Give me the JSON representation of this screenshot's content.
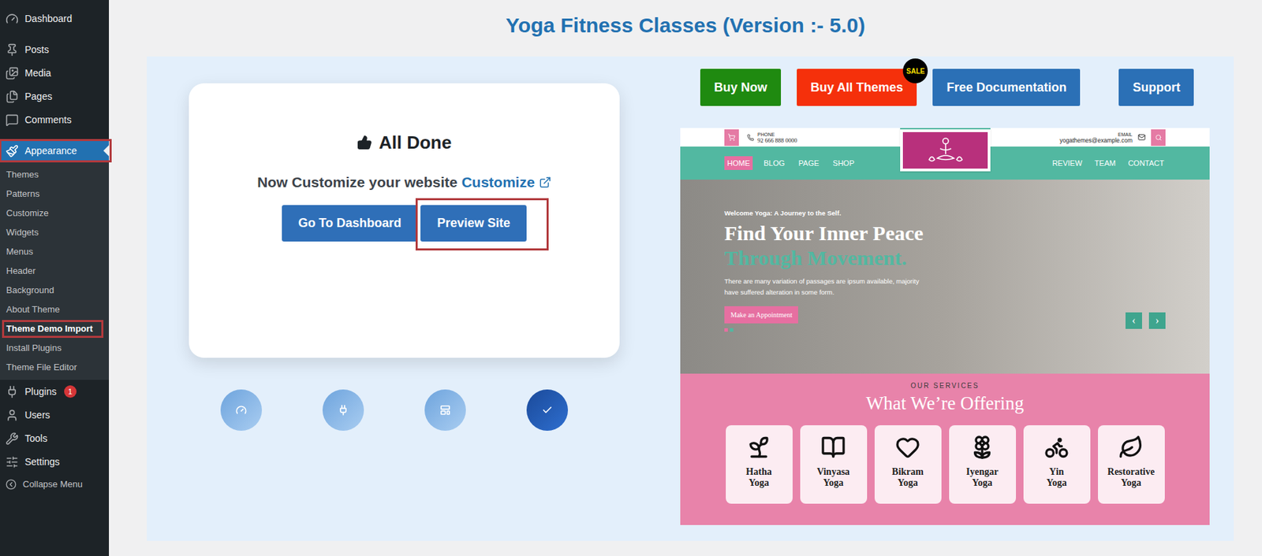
{
  "sidebar": {
    "items": [
      {
        "label": "Dashboard",
        "selected": false,
        "highlighted": false
      },
      {
        "label": "Posts",
        "selected": false,
        "highlighted": false
      },
      {
        "label": "Media",
        "selected": false,
        "highlighted": false
      },
      {
        "label": "Pages",
        "selected": false,
        "highlighted": false
      },
      {
        "label": "Comments",
        "selected": false,
        "highlighted": false
      },
      {
        "label": "Appearance",
        "selected": true,
        "highlighted": true,
        "submenu": [
          {
            "label": "Themes",
            "selected": false,
            "highlighted": false
          },
          {
            "label": "Patterns",
            "selected": false,
            "highlighted": false
          },
          {
            "label": "Customize",
            "selected": false,
            "highlighted": false
          },
          {
            "label": "Widgets",
            "selected": false,
            "highlighted": false
          },
          {
            "label": "Menus",
            "selected": false,
            "highlighted": false
          },
          {
            "label": "Header",
            "selected": false,
            "highlighted": false
          },
          {
            "label": "Background",
            "selected": false,
            "highlighted": false
          },
          {
            "label": "About Theme",
            "selected": false,
            "highlighted": false
          },
          {
            "label": "Theme Demo Import",
            "selected": true,
            "highlighted": true
          },
          {
            "label": "Install Plugins",
            "selected": false,
            "highlighted": false
          },
          {
            "label": "Theme File Editor",
            "selected": false,
            "highlighted": false
          }
        ]
      },
      {
        "label": "Plugins",
        "selected": false,
        "highlighted": false,
        "badge": "1"
      },
      {
        "label": "Users",
        "selected": false,
        "highlighted": false
      },
      {
        "label": "Tools",
        "selected": false,
        "highlighted": false
      },
      {
        "label": "Settings",
        "selected": false,
        "highlighted": false
      }
    ],
    "collapse": "Collapse Menu"
  },
  "page": {
    "title": "Yoga Fitness Classes (Version :- 5.0)"
  },
  "wizard": {
    "heading": "All Done",
    "prompt": "Now Customize your website",
    "customize_link": "Customize",
    "buttons": [
      {
        "label": "Go To Dashboard",
        "highlighted": false
      },
      {
        "label": "Preview Site",
        "highlighted": true
      }
    ],
    "steps": [
      {
        "selected": false
      },
      {
        "selected": false
      },
      {
        "selected": false
      },
      {
        "selected": true
      }
    ]
  },
  "actions": [
    {
      "label": "Buy Now",
      "color": "#1f8a10"
    },
    {
      "label": "Buy All Themes",
      "color": "#f5300b",
      "badge": "SALE"
    },
    {
      "label": "Free Documentation",
      "color": "#2b70b6"
    },
    {
      "label": "Support",
      "color": "#2b70b6"
    }
  ],
  "preview": {
    "phone_label": "PHONE",
    "phone": "92 666 888 0000",
    "email_label": "EMAIL",
    "email": "yogathemes@example.com",
    "nav_left": [
      {
        "label": "HOME",
        "selected": true
      },
      {
        "label": "BLOG",
        "selected": false
      },
      {
        "label": "PAGE",
        "selected": false
      },
      {
        "label": "SHOP",
        "selected": false
      }
    ],
    "nav_right": [
      {
        "label": "REVIEW",
        "selected": false
      },
      {
        "label": "TEAM",
        "selected": false
      },
      {
        "label": "CONTACT",
        "selected": false
      }
    ],
    "hero": {
      "kicker": "Welcome Yoga: A Journey to the Self.",
      "title_1": "Find Your Inner Peace",
      "title_2": "Through Movement.",
      "text": "There are many variation of passages are ipsum available, majority have suffered alteration in some form.",
      "button": "Make an Appointment",
      "slides": [
        {
          "selected": true
        },
        {
          "selected": false
        }
      ],
      "prev": "‹",
      "next": "›"
    },
    "services": {
      "kicker": "OUR SERVICES",
      "title": "What We’re Offering",
      "cards": [
        {
          "name": "Hatha Yoga"
        },
        {
          "name": "Vinyasa Yoga"
        },
        {
          "name": "Bikram Yoga"
        },
        {
          "name": "Iyengar Yoga"
        },
        {
          "name": "Yin Yoga"
        },
        {
          "name": "Restorative Yoga"
        }
      ]
    }
  }
}
